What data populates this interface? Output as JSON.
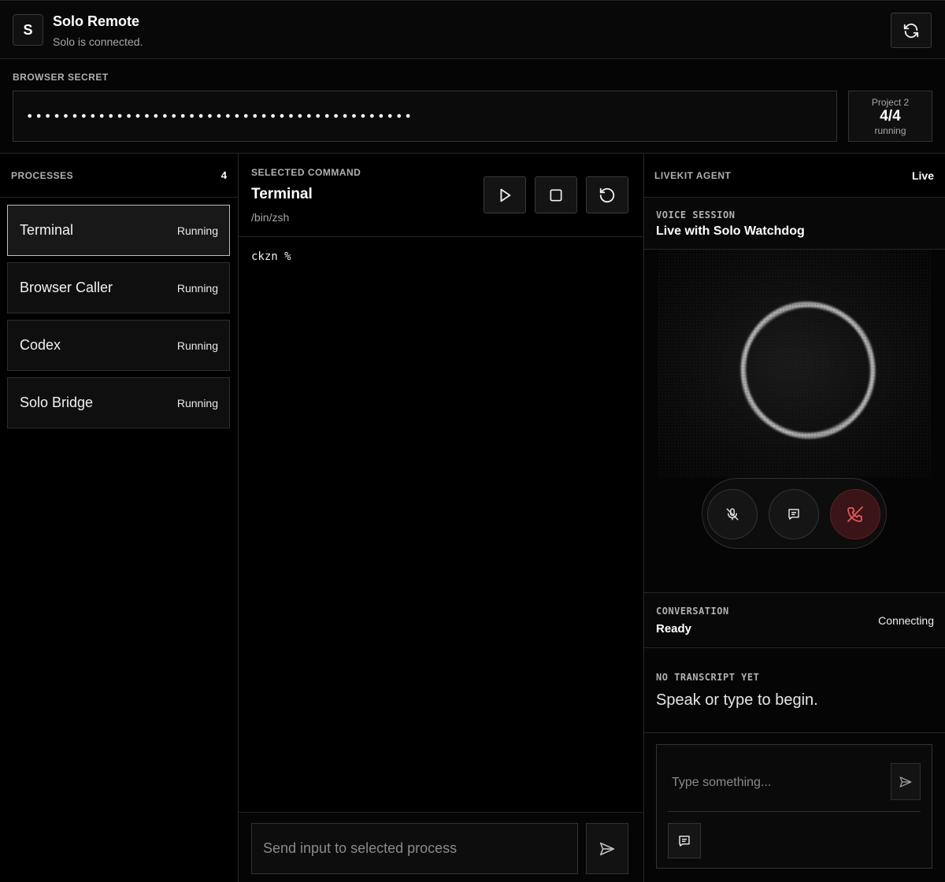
{
  "app": {
    "logo_letter": "S",
    "title": "Solo Remote",
    "status": "Solo is connected."
  },
  "icons": {
    "refresh": "refresh-icon",
    "play": "play-icon",
    "stop": "stop-icon",
    "restart": "restart-icon",
    "send": "send-icon",
    "mic_off": "mic-off-icon",
    "chat": "chat-icon",
    "end_call": "end-call-icon"
  },
  "secret": {
    "label": "BROWSER SECRET",
    "value": "•••••••••••••••••••••••••••••••••••••••••••"
  },
  "project": {
    "name": "Project 2",
    "count": "4/4",
    "state": "running"
  },
  "processes": {
    "label": "PROCESSES",
    "count": "4",
    "items": [
      {
        "name": "Terminal",
        "state": "Running",
        "active": true
      },
      {
        "name": "Browser Caller",
        "state": "Running",
        "active": false
      },
      {
        "name": "Codex",
        "state": "Running",
        "active": false
      },
      {
        "name": "Solo Bridge",
        "state": "Running",
        "active": false
      }
    ]
  },
  "command": {
    "label": "SELECTED COMMAND",
    "title": "Terminal",
    "path": "/bin/zsh",
    "terminal_output": "ckzn %",
    "input_placeholder": "Send input to selected process"
  },
  "agent": {
    "label": "LIVEKIT AGENT",
    "status": "Live",
    "voice_label": "VOICE SESSION",
    "voice_title": "Live with Solo Watchdog",
    "conversation_label": "CONVERSATION",
    "conversation_title": "Ready",
    "conversation_state": "Connecting",
    "transcript_label": "NO TRANSCRIPT YET",
    "transcript_hint": "Speak or type to begin.",
    "chat_placeholder": "Type something..."
  },
  "colors": {
    "background": "#000000",
    "border": "#262626",
    "end_call": "#e05a5f"
  }
}
